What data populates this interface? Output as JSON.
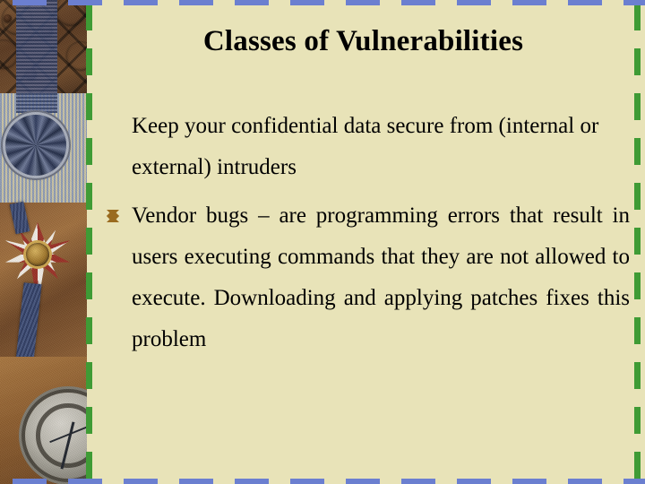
{
  "slide": {
    "title": "Classes of Vulnerabilities",
    "background_color": "#e8e3b8",
    "title_color": "#000000",
    "body_color": "#000000"
  },
  "borders": {
    "left_color": "#3f9b35",
    "right_color": "#3f9b35",
    "top_color": "#6b7fd0",
    "bottom_color": "#6b7fd0"
  },
  "body": {
    "intro_paragraph": "Keep your confidential data secure from (internal or external) intruders",
    "bullet_glyph": "diamond-bullet",
    "bullet_color": "#9a6b1f",
    "bullet_paragraph": "Vendor bugs – are programming errors that result in users executing commands that they are not allowed to execute. Downloading and applying patches fixes this problem"
  },
  "decoration": {
    "photo_name": "medals-coins-compass-photo"
  }
}
